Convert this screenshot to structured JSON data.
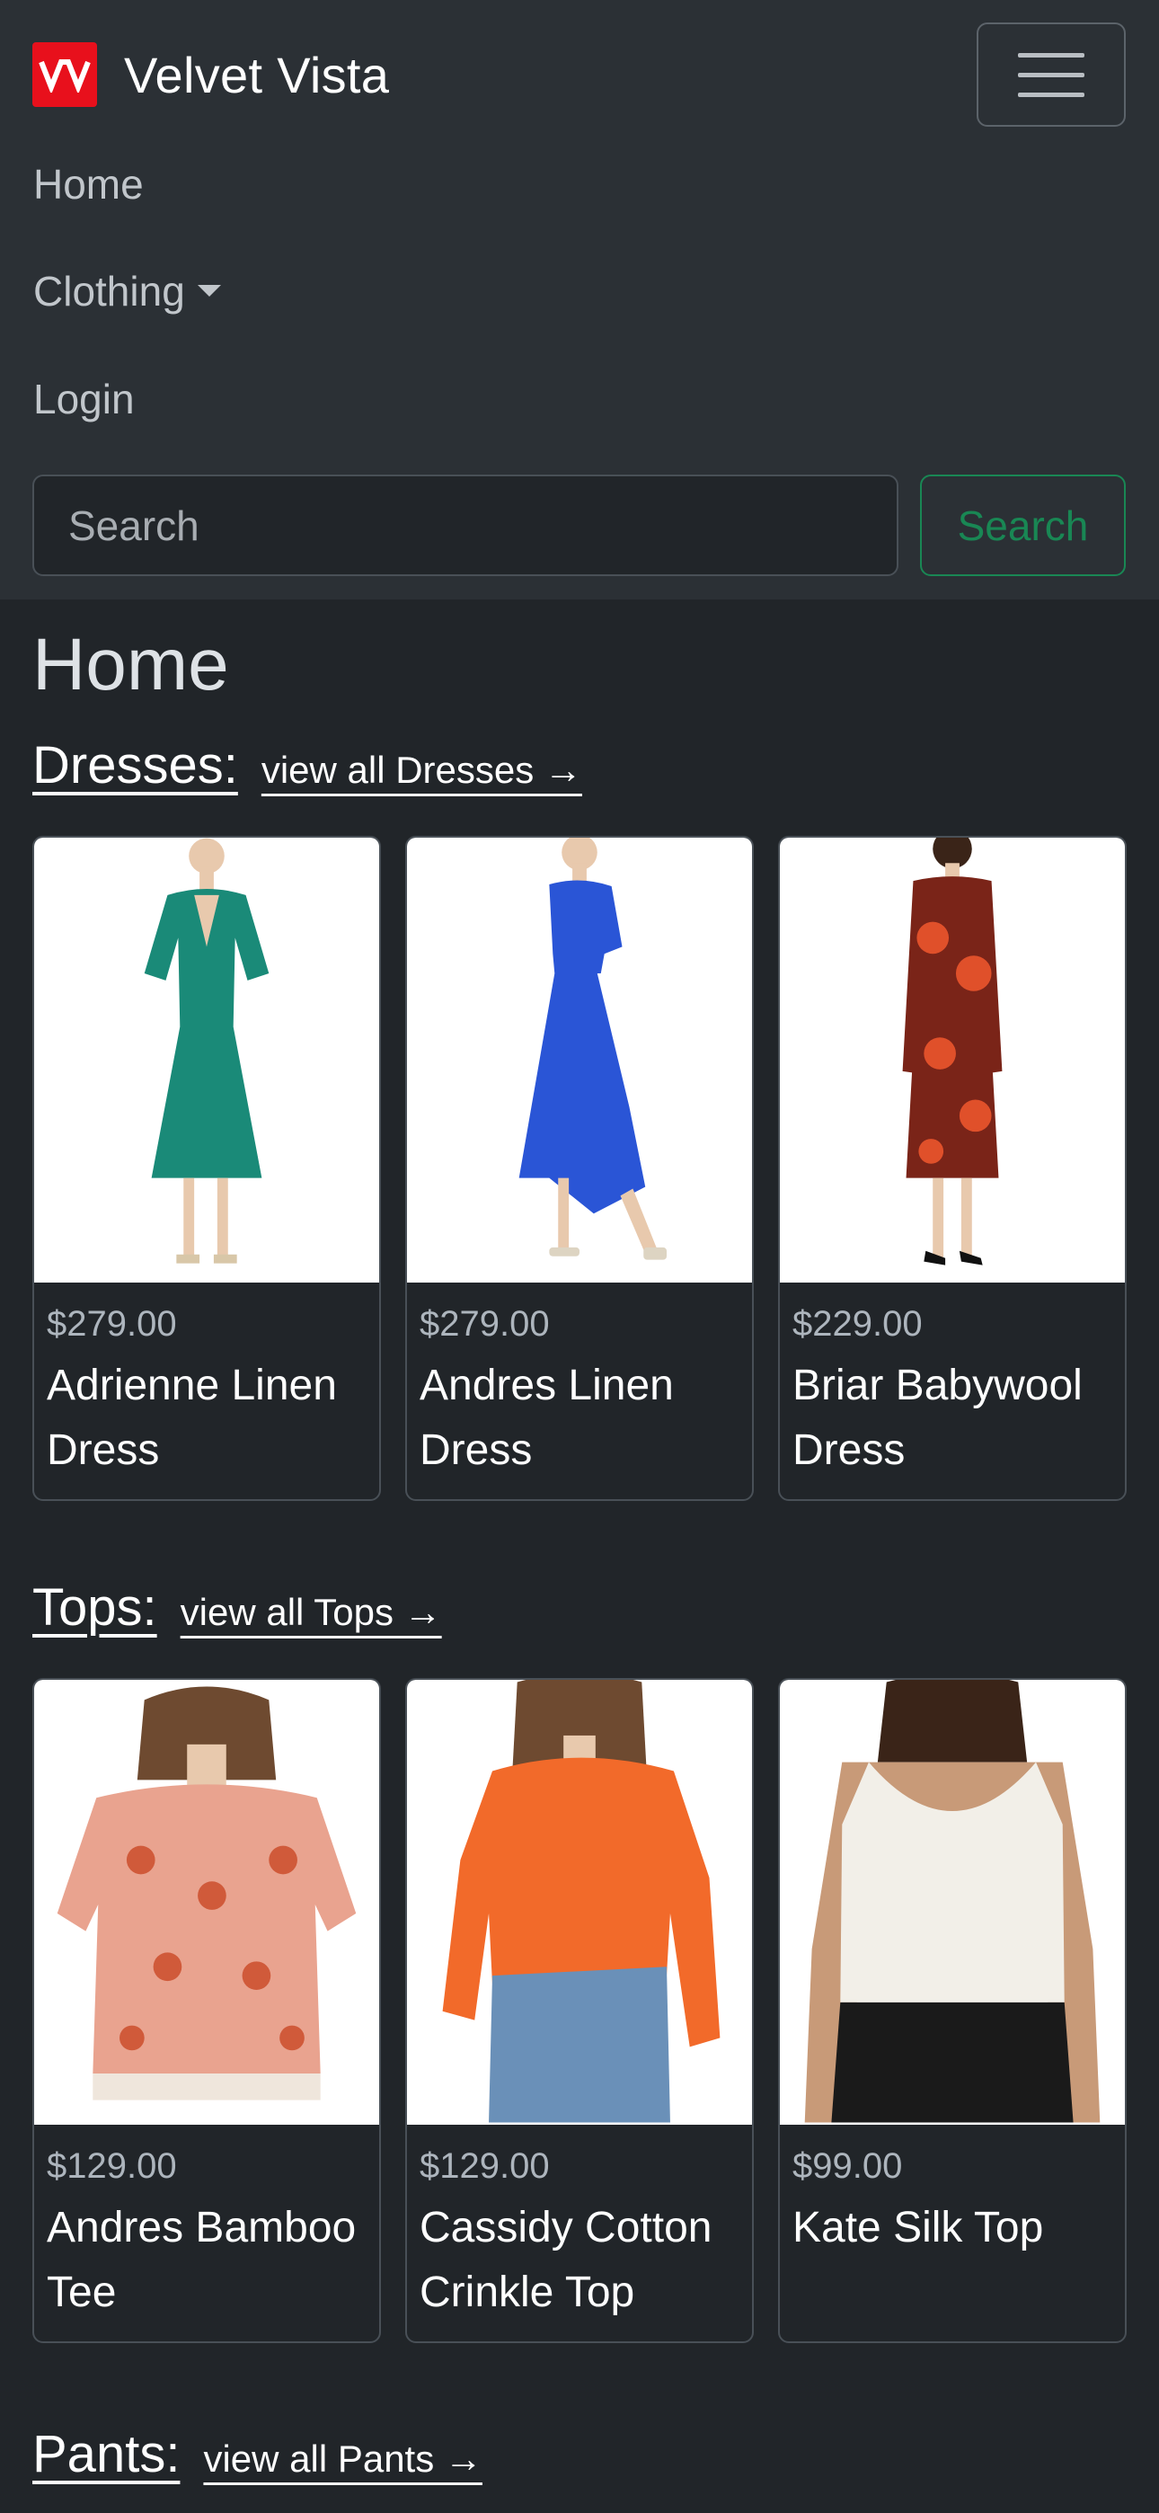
{
  "navbar": {
    "brand_name": "Velvet Vista",
    "links": [
      "Home",
      "Clothing",
      "Login"
    ],
    "search_placeholder": "Search",
    "search_button": "Search"
  },
  "main": {
    "page_title": "Home",
    "sections": [
      {
        "title": "Dresses:",
        "view_all": "view all Dresses →",
        "products": [
          {
            "price": "$279.00",
            "name": "Adrienne Linen Dress",
            "color": "#1a8a78"
          },
          {
            "price": "$279.00",
            "name": "Andres Linen Dress",
            "color": "#2a55d6"
          },
          {
            "price": "$229.00",
            "name": "Briar Babywool Dress",
            "color": "#7a2418"
          }
        ]
      },
      {
        "title": "Tops:",
        "view_all": "view all Tops →",
        "products": [
          {
            "price": "$129.00",
            "name": "Andres Bamboo Tee",
            "color": "#e9a38f"
          },
          {
            "price": "$129.00",
            "name": "Cassidy Cotton Crinkle Top",
            "color": "#f26a2a"
          },
          {
            "price": "$99.00",
            "name": "Kate Silk Top",
            "color": "#f2efe8"
          }
        ]
      },
      {
        "title": "Pants:",
        "view_all": "view all Pants →"
      }
    ]
  },
  "colors": {
    "background": "#212529",
    "navbar": "#2b3035",
    "brand": "#e8101c",
    "success": "#198754"
  }
}
